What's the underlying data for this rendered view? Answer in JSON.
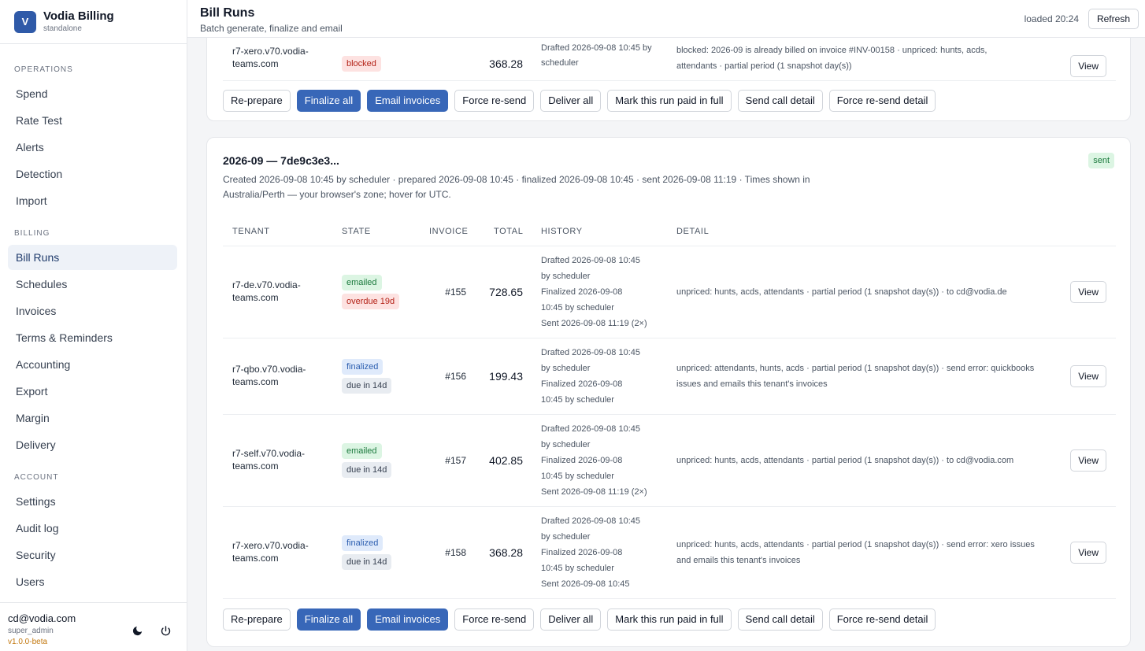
{
  "brand": {
    "logo": "V",
    "name": "Vodia Billing",
    "sub": "standalone"
  },
  "nav": {
    "operations_label": "OPERATIONS",
    "operations": [
      "Spend",
      "Rate Test",
      "Alerts",
      "Detection",
      "Import"
    ],
    "billing_label": "BILLING",
    "billing": [
      "Bill Runs",
      "Schedules",
      "Invoices",
      "Terms & Reminders",
      "Accounting",
      "Export",
      "Margin",
      "Delivery"
    ],
    "account_label": "ACCOUNT",
    "account": [
      "Settings",
      "Audit log",
      "Security",
      "Users"
    ],
    "active": "Bill Runs"
  },
  "user": {
    "email": "cd@vodia.com",
    "role": "super_admin",
    "version": "v1.0.0-beta"
  },
  "icons": {
    "theme": "moon-icon",
    "logout": "power-icon"
  },
  "header": {
    "title": "Bill Runs",
    "subtitle": "Batch generate, finalize and email",
    "loaded": "loaded 20:24",
    "refresh": "Refresh"
  },
  "actions": [
    "Re-prepare",
    "Finalize all",
    "Email invoices",
    "Force re-send",
    "Deliver all",
    "Mark this run paid in full",
    "Send call detail",
    "Force re-send detail"
  ],
  "prev_run": {
    "row": {
      "tenant": "r7-xero.v70.vodia-teams.com",
      "state": [
        "blocked"
      ],
      "total": "368.28",
      "history": [
        "Drafted 2026-09-08 10:45 by",
        "scheduler"
      ],
      "detail": "blocked: 2026-09 is already billed on invoice #INV-00158 · unpriced: hunts, acds, attendants · partial period (1 snapshot day(s))",
      "view": "View"
    }
  },
  "run": {
    "title": "2026-09 — 7de9c3e3...",
    "status": "sent",
    "meta": "Created 2026-09-08 10:45 by scheduler · prepared 2026-09-08 10:45 · finalized 2026-09-08 10:45 · sent 2026-09-08 11:19 · Times shown in Australia/Perth — your browser's zone; hover for UTC.",
    "columns": [
      "TENANT",
      "STATE",
      "INVOICE",
      "TOTAL",
      "HISTORY",
      "DETAIL"
    ],
    "rows": [
      {
        "tenant": "r7-de.v70.vodia-teams.com",
        "state": [
          "emailed",
          "overdue 19d"
        ],
        "invoice": "#155",
        "total": "728.65",
        "history": [
          "Drafted 2026-09-08 10:45",
          "by scheduler",
          "Finalized 2026-09-08",
          "10:45 by scheduler",
          "Sent 2026-09-08 11:19 (2×)"
        ],
        "detail": "unpriced: hunts, acds, attendants · partial period (1 snapshot day(s)) · to cd@vodia.de",
        "view": "View"
      },
      {
        "tenant": "r7-qbo.v70.vodia-teams.com",
        "state": [
          "finalized",
          "due in 14d"
        ],
        "invoice": "#156",
        "total": "199.43",
        "history": [
          "Drafted 2026-09-08 10:45",
          "by scheduler",
          "Finalized 2026-09-08",
          "10:45 by scheduler"
        ],
        "detail": "unpriced: attendants, hunts, acds · partial period (1 snapshot day(s)) · send error: quickbooks issues and emails this tenant's invoices",
        "view": "View"
      },
      {
        "tenant": "r7-self.v70.vodia-teams.com",
        "state": [
          "emailed",
          "due in 14d"
        ],
        "invoice": "#157",
        "total": "402.85",
        "history": [
          "Drafted 2026-09-08 10:45",
          "by scheduler",
          "Finalized 2026-09-08",
          "10:45 by scheduler",
          "Sent 2026-09-08 11:19 (2×)"
        ],
        "detail": "unpriced: hunts, acds, attendants · partial period (1 snapshot day(s)) · to cd@vodia.com",
        "view": "View"
      },
      {
        "tenant": "r7-xero.v70.vodia-teams.com",
        "state": [
          "finalized",
          "due in 14d"
        ],
        "invoice": "#158",
        "total": "368.28",
        "history": [
          "Drafted 2026-09-08 10:45",
          "by scheduler",
          "Finalized 2026-09-08",
          "10:45 by scheduler",
          "Sent 2026-09-08 10:45"
        ],
        "detail": "unpriced: hunts, acds, attendants · partial period (1 snapshot day(s)) · send error: xero issues and emails this tenant's invoices",
        "view": "View"
      }
    ]
  }
}
